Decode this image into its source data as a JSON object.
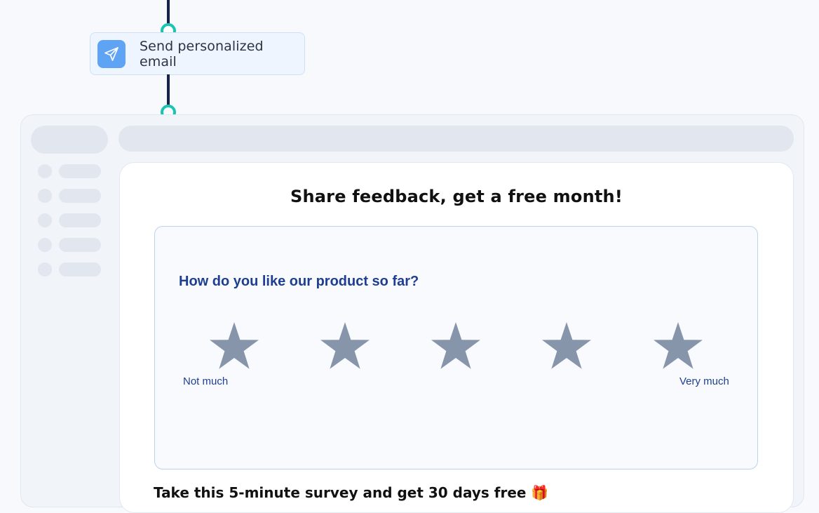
{
  "flow": {
    "action": {
      "label": "Send personalized email",
      "icon": "send-paper-plane-icon",
      "icon_color": "#5fa3f5"
    },
    "connector_color": "#17234d",
    "node_dot_color": "#18c4b4"
  },
  "email": {
    "heading": "Share feedback, get a free month!",
    "survey": {
      "question": "How do you like our product so far?",
      "rating_max": 5,
      "rating_selected": 0,
      "star_color": "#8795ab",
      "low_label": "Not much",
      "high_label": "Very much"
    },
    "footer_text": "Take this 5-minute survey and get 30 days free 🎁"
  }
}
